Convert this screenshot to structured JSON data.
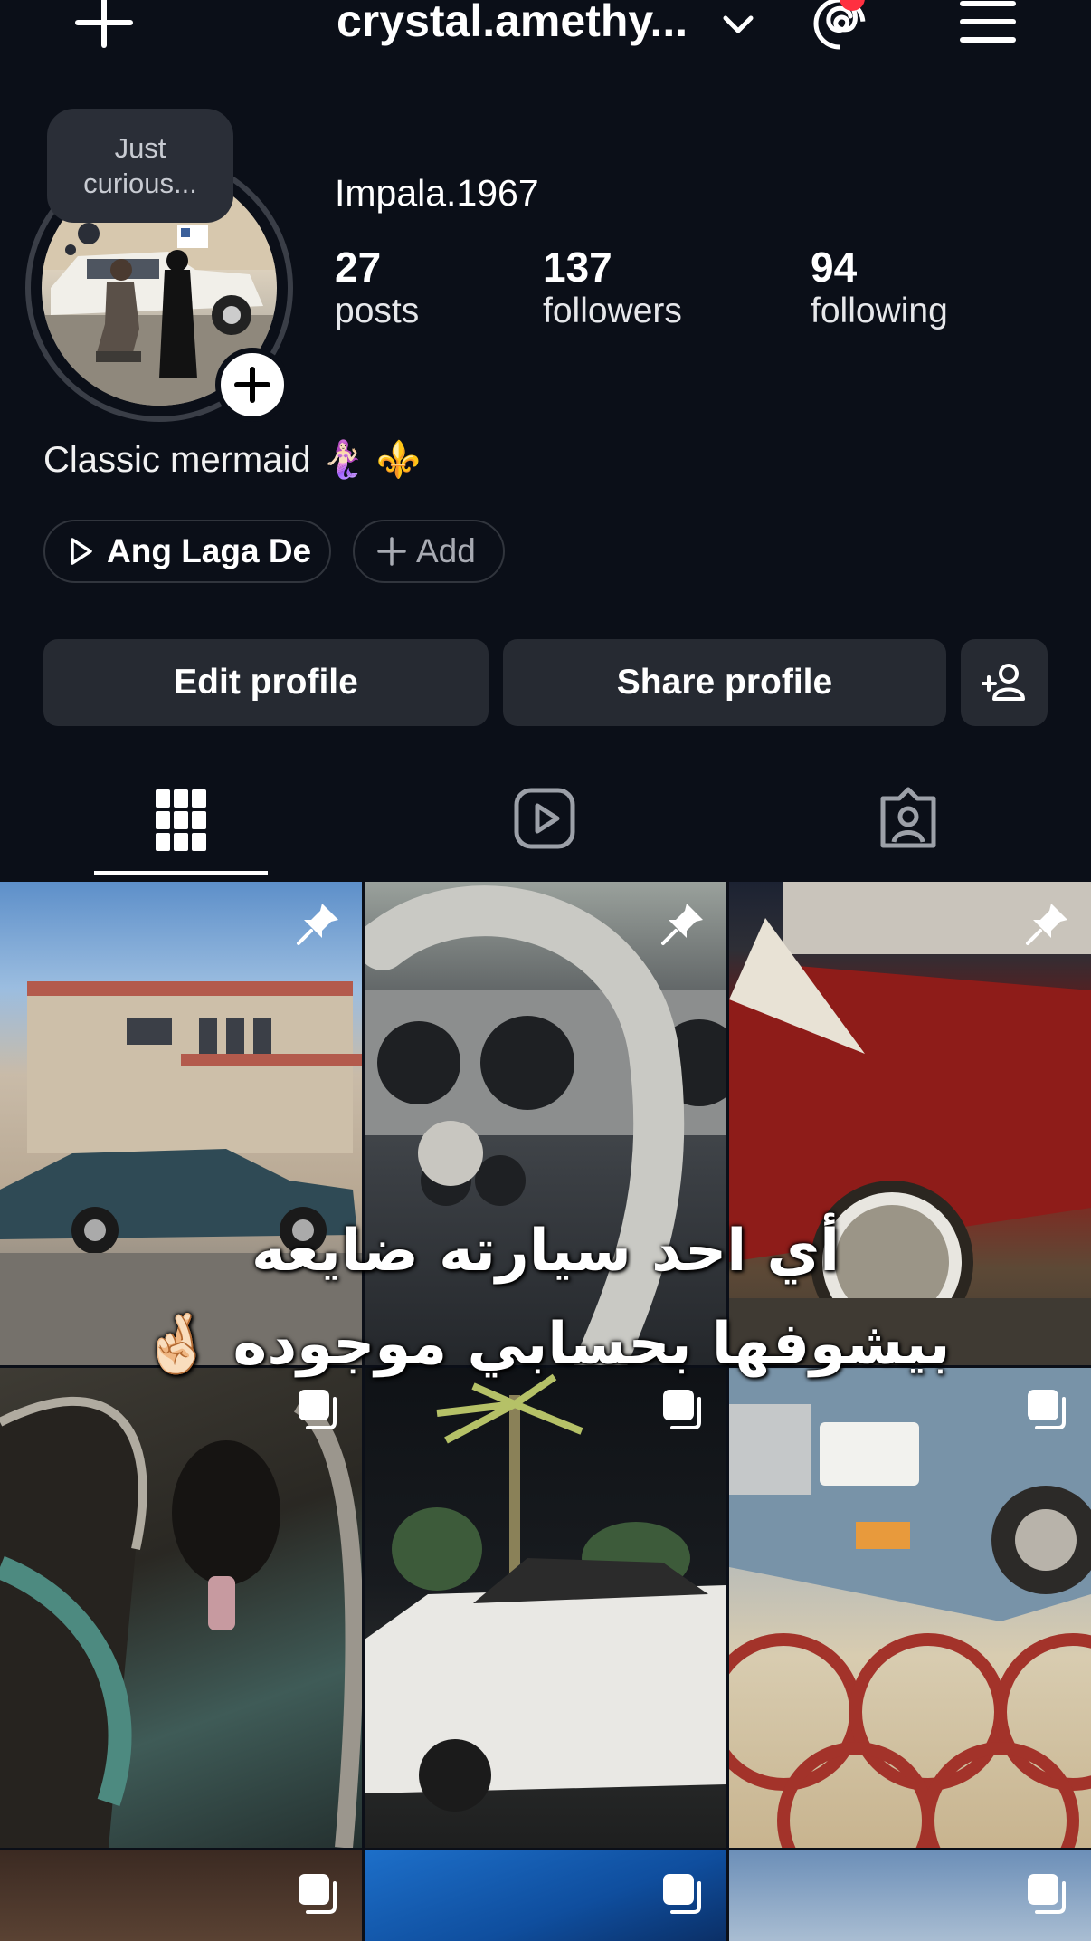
{
  "header": {
    "title": "crystal.amethy...",
    "icons": [
      "plus-icon",
      "chevron-down-icon",
      "threads-icon",
      "menu-icon"
    ]
  },
  "profile": {
    "note": "Just curious...",
    "name": "Impala.1967",
    "stats": [
      {
        "value": "27",
        "label": "posts"
      },
      {
        "value": "137",
        "label": "followers"
      },
      {
        "value": "94",
        "label": "following"
      }
    ],
    "bio": "Classic mermaid 🧜🏻‍♀️ ⚜️"
  },
  "chips": {
    "music": "Ang Laga De",
    "add": "Add"
  },
  "actions": {
    "edit": "Edit profile",
    "share": "Share profile"
  },
  "tabs": [
    "grid-icon",
    "reels-icon",
    "tagged-icon"
  ],
  "overlay": {
    "line1": "أي احد سيارته ضايعه",
    "line2": "بيشوفها بحسابي موجوده 🤞🏻"
  },
  "colors": {
    "background": "#0b0f18",
    "button": "#262a32",
    "notification": "#ff3040"
  }
}
